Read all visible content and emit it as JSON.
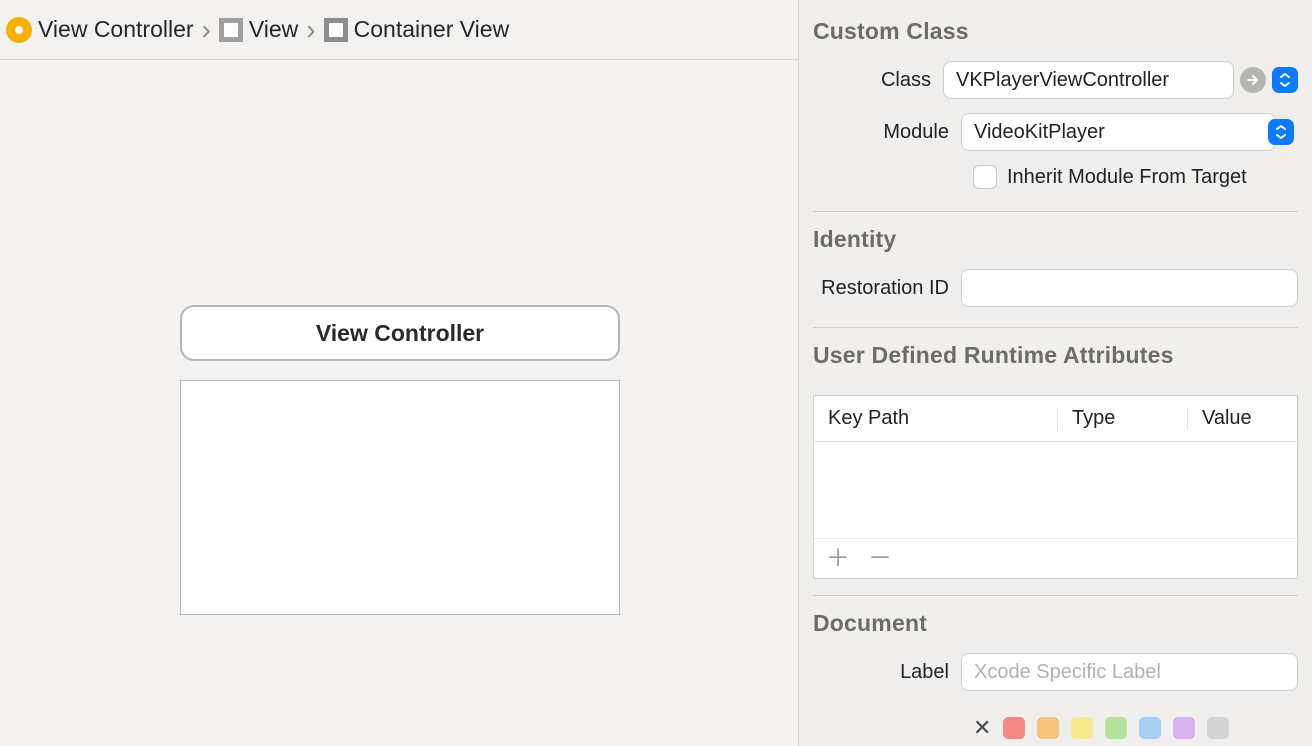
{
  "breadcrumbs": {
    "items": [
      {
        "label": "View Controller"
      },
      {
        "label": "View"
      },
      {
        "label": "Container View"
      }
    ]
  },
  "scene": {
    "title": "View Controller"
  },
  "inspector": {
    "customClass": {
      "section": "Custom Class",
      "classLabel": "Class",
      "classValue": "VKPlayerViewController",
      "moduleLabel": "Module",
      "moduleValue": "VideoKitPlayer",
      "inheritLabel": "Inherit Module From Target",
      "inheritChecked": false
    },
    "identity": {
      "section": "Identity",
      "restorationLabel": "Restoration ID",
      "restorationValue": ""
    },
    "runtimeAttrs": {
      "section": "User Defined Runtime Attributes",
      "headers": {
        "keyPath": "Key Path",
        "type": "Type",
        "value": "Value"
      },
      "rows": []
    },
    "document": {
      "section": "Document",
      "labelLabel": "Label",
      "labelPlaceholder": "Xcode Specific Label",
      "colors": [
        "#f38b82",
        "#f4c57c",
        "#f6ea8c",
        "#b3e29b",
        "#a9cef4",
        "#d9b3ef",
        "#d3d3d3"
      ]
    }
  }
}
